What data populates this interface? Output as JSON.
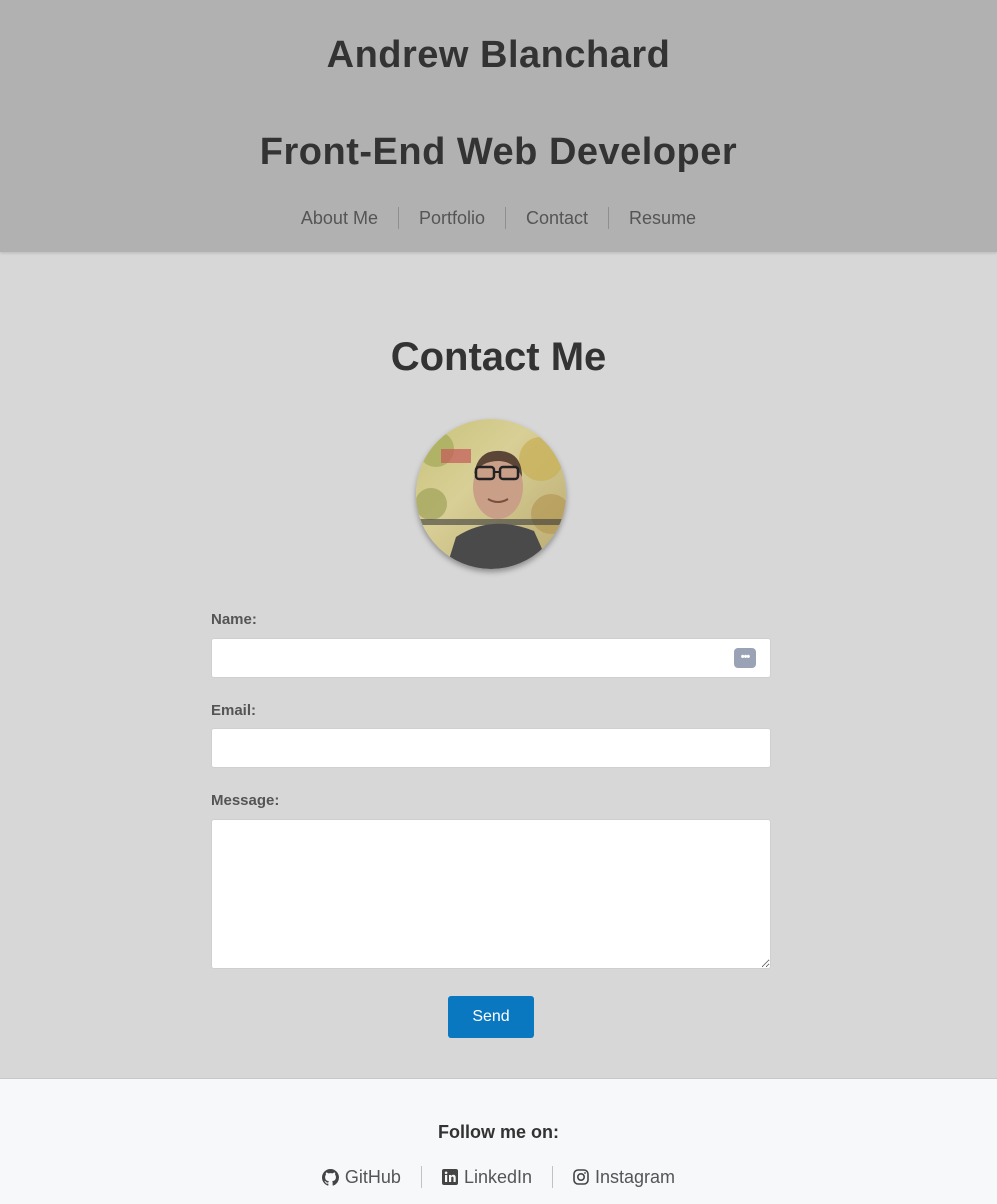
{
  "header": {
    "name": "Andrew Blanchard",
    "role": "Front-End Web Developer",
    "nav": [
      {
        "label": "About Me"
      },
      {
        "label": "Portfolio"
      },
      {
        "label": "Contact"
      },
      {
        "label": "Resume"
      }
    ]
  },
  "contact": {
    "title": "Contact Me",
    "avatar_icon": "profile-photo",
    "name_label": "Name:",
    "name_value": "",
    "name_autofill_icon": "password-manager-icon",
    "email_label": "Email:",
    "email_value": "",
    "message_label": "Message:",
    "message_value": "",
    "send_label": "Send"
  },
  "footer": {
    "follow": "Follow me on:",
    "links": [
      {
        "label": "GitHub",
        "icon": "github-icon"
      },
      {
        "label": "LinkedIn",
        "icon": "linkedin-icon"
      },
      {
        "label": "Instagram",
        "icon": "instagram-icon"
      }
    ]
  },
  "colors": {
    "header_bg": "#b1b1b1",
    "main_bg": "#d7d7d7",
    "footer_bg": "#f7f8fa",
    "button_bg": "#0a78c1",
    "text": "#333333"
  }
}
